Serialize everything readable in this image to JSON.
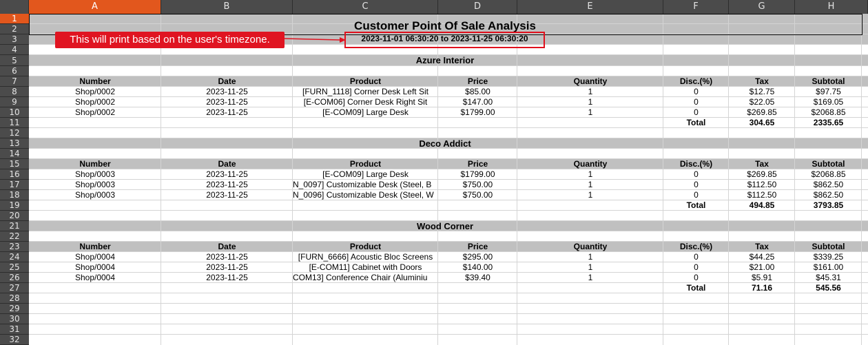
{
  "columns": [
    "A",
    "B",
    "C",
    "D",
    "E",
    "F",
    "G",
    "H"
  ],
  "rows": [
    "1",
    "2",
    "3",
    "4",
    "5",
    "6",
    "7",
    "8",
    "9",
    "10",
    "11",
    "12",
    "13",
    "14",
    "15",
    "16",
    "17",
    "18",
    "19",
    "20",
    "21",
    "22",
    "23",
    "24",
    "25",
    "26",
    "27",
    "28",
    "29",
    "30",
    "31",
    "32"
  ],
  "report": {
    "title": "Customer Point Of Sale Analysis",
    "period": "2023-11-01 06:30:20 to 2023-11-25 06:30:20",
    "annotation": "This will print based on the user's timezone."
  },
  "headers": [
    "Number",
    "Date",
    "Product",
    "Price",
    "Quantity",
    "Disc.(%)",
    "Tax",
    "Subtotal"
  ],
  "total_label": "Total",
  "sections": [
    {
      "customer": "Azure Interior",
      "lines": [
        [
          "Shop/0002",
          "2023-11-25",
          "[FURN_1118] Corner Desk Left Sit",
          "$85.00",
          "1",
          "0",
          "$12.75",
          "$97.75"
        ],
        [
          "Shop/0002",
          "2023-11-25",
          "[E-COM06] Corner Desk Right Sit",
          "$147.00",
          "1",
          "0",
          "$22.05",
          "$169.05"
        ],
        [
          "Shop/0002",
          "2023-11-25",
          "[E-COM09] Large Desk",
          "$1799.00",
          "1",
          "0",
          "$269.85",
          "$2068.85"
        ]
      ],
      "total_tax": "304.65",
      "total_subtotal": "2335.65"
    },
    {
      "customer": "Deco Addict",
      "lines": [
        [
          "Shop/0003",
          "2023-11-25",
          "[E-COM09] Large Desk",
          "$1799.00",
          "1",
          "0",
          "$269.85",
          "$2068.85"
        ],
        [
          "Shop/0003",
          "2023-11-25",
          "N_0097] Customizable Desk (Steel, B",
          "$750.00",
          "1",
          "0",
          "$112.50",
          "$862.50"
        ],
        [
          "Shop/0003",
          "2023-11-25",
          "N_0096] Customizable Desk (Steel, W",
          "$750.00",
          "1",
          "0",
          "$112.50",
          "$862.50"
        ]
      ],
      "total_tax": "494.85",
      "total_subtotal": "3793.85"
    },
    {
      "customer": "Wood Corner",
      "lines": [
        [
          "Shop/0004",
          "2023-11-25",
          "[FURN_6666] Acoustic Bloc Screens",
          "$295.00",
          "1",
          "0",
          "$44.25",
          "$339.25"
        ],
        [
          "Shop/0004",
          "2023-11-25",
          "[E-COM11] Cabinet with Doors",
          "$140.00",
          "1",
          "0",
          "$21.00",
          "$161.00"
        ],
        [
          "Shop/0004",
          "2023-11-25",
          "COM13] Conference Chair (Aluminiu",
          "$39.40",
          "1",
          "0",
          "$5.91",
          "$45.31"
        ]
      ],
      "total_tax": "71.16",
      "total_subtotal": "545.56"
    }
  ],
  "colors": {
    "header_bg": "#4b4b4b",
    "selected_header": "#e2571d",
    "band_gray": "#c0c0c0",
    "annotation_red": "#e01421"
  }
}
